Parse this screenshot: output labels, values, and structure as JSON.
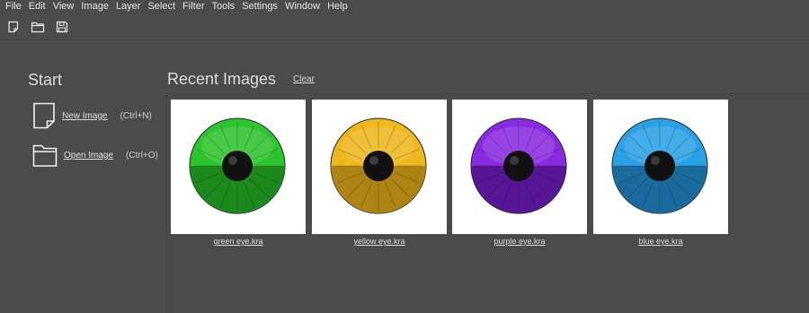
{
  "menu": [
    "File",
    "Edit",
    "View",
    "Image",
    "Layer",
    "Select",
    "Filter",
    "Tools",
    "Settings",
    "Window",
    "Help"
  ],
  "toolbar": {
    "icons": [
      "new-document-icon",
      "open-folder-icon",
      "save-icon"
    ]
  },
  "start": {
    "title": "Start",
    "new_image": {
      "label": "New Image",
      "shortcut": "(Ctrl+N)",
      "icon": "new-document-icon"
    },
    "open_image": {
      "label": "Open Image",
      "shortcut": "(Ctrl+O)",
      "icon": "open-folder-icon"
    }
  },
  "recent": {
    "title": "Recent Images",
    "clear_label": "Clear",
    "images": [
      {
        "name": "green eye.kra",
        "color": "#2ec42e",
        "dark": "#1a7f1a"
      },
      {
        "name": "yellow eye.kra",
        "color": "#efb81e",
        "dark": "#a17a12"
      },
      {
        "name": "purple eye.kra",
        "color": "#8a2be2",
        "dark": "#4e1388"
      },
      {
        "name": "blue eye.kra",
        "color": "#2aa1e6",
        "dark": "#17608f"
      }
    ]
  },
  "colors": {
    "background": "#4b4b4b",
    "text": "#e2e2e2"
  }
}
